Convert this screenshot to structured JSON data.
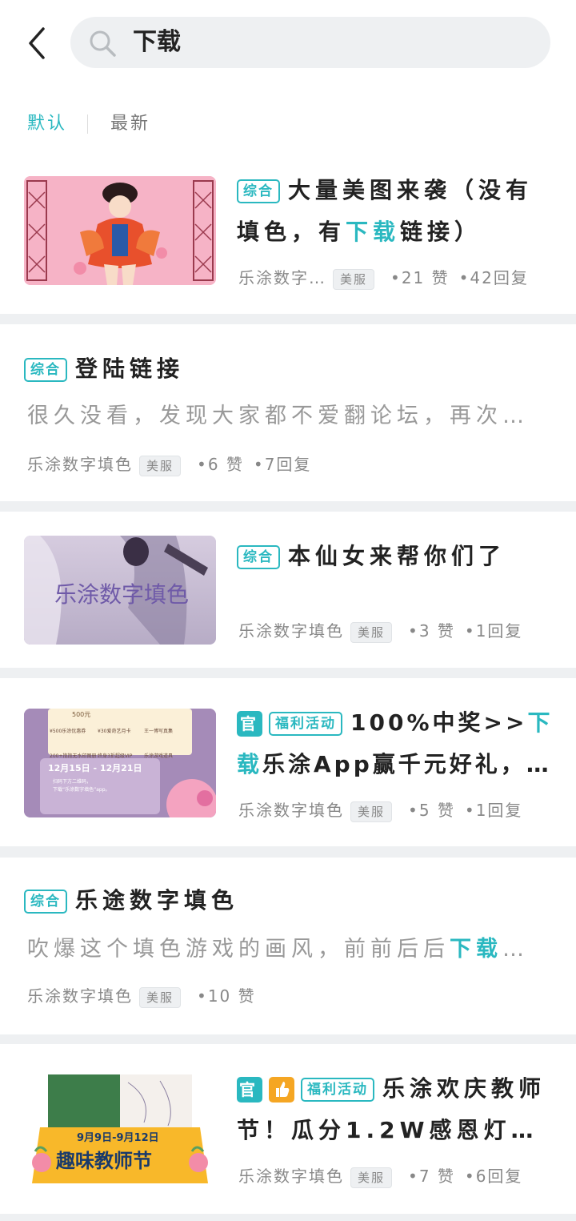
{
  "header": {
    "back_icon": "chevron-left-icon",
    "search_icon": "search-icon",
    "search_query": "下载"
  },
  "sort_tabs": {
    "active": "默认",
    "other": "最新"
  },
  "colors": {
    "accent": "#2ab8c0",
    "thumbs_up": "#f5a623",
    "page_bg": "#eef0f2"
  },
  "posts": [
    {
      "tag": "综合",
      "title_parts": [
        "大量美图来袭（没有填色，有",
        "下载",
        "链接）"
      ],
      "author": "乐涂数字…",
      "platform": "美服",
      "likes": "21 赞",
      "replies": "42回复"
    },
    {
      "tag": "综合",
      "title": "登陆链接",
      "excerpt": "很久没看，发现大家都不爱翻论坛，再次…",
      "author": "乐涂数字填色",
      "platform": "美服",
      "likes": "6 赞",
      "replies": "7回复"
    },
    {
      "tag": "综合",
      "title": "本仙女来帮你们了",
      "thumb_text": "乐涂数字填色",
      "author": "乐涂数字填色",
      "platform": "美服",
      "likes": "3 赞",
      "replies": "1回复"
    },
    {
      "official": "官",
      "tag": "福利活动",
      "title_parts": [
        "100%中奖>>",
        "下载",
        "乐涂App赢千元好礼，…"
      ],
      "thumb": {
        "price": "500元",
        "items": [
          "¥500乐涂优惠券",
          "¥30爱奇艺月卡",
          "王一博写真集",
          "200+抱抱无水印图册",
          "终身3折超级VIP",
          "乐涂游戏道具"
        ],
        "date": "12月15日 - 12月21日",
        "scan_line1": "扫码下方二维码，",
        "scan_line2": "下载“乐涂数字填色”app。"
      },
      "author": "乐涂数字填色",
      "platform": "美服",
      "likes": "5 赞",
      "replies": "1回复"
    },
    {
      "tag": "综合",
      "title": "乐途数字填色",
      "excerpt_parts": [
        "吹爆这个填色游戏的画风，前前后后",
        "下载",
        "…"
      ],
      "author": "乐涂数字填色",
      "platform": "美服",
      "likes": "10 赞"
    },
    {
      "official": "官",
      "thumbs_icon": "thumbs-up-icon",
      "tag": "福利活动",
      "title": "乐涂欢庆教师节！瓜分1.2W感恩灯…",
      "thumb": {
        "date": "9月9日-9月12日",
        "headline": "趣味教师节"
      },
      "author": "乐涂数字填色",
      "platform": "美服",
      "likes": "7 赞",
      "replies": "6回复"
    }
  ]
}
